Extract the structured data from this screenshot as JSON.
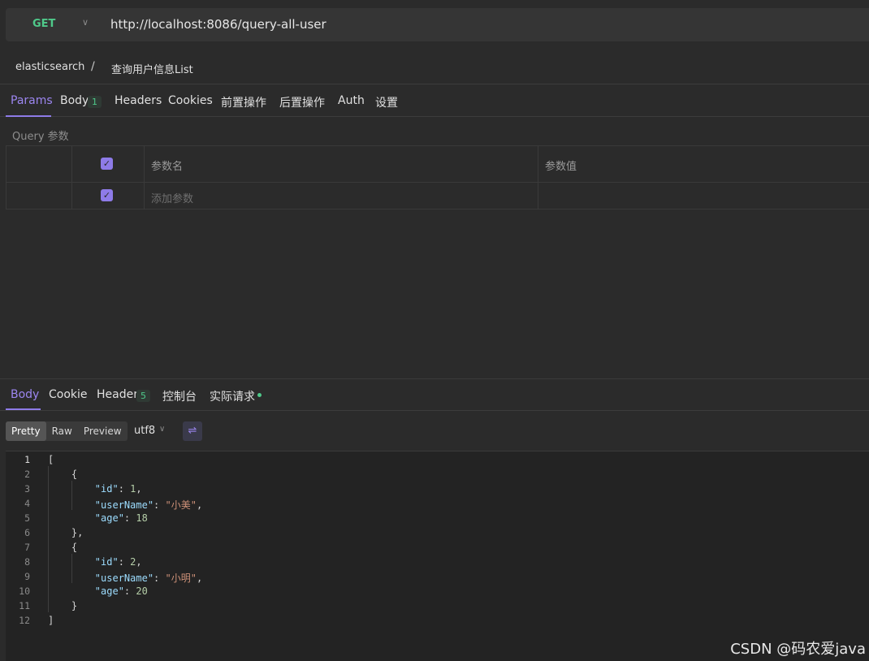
{
  "request": {
    "method": "GET",
    "url": "http://localhost:8086/query-all-user"
  },
  "breadcrumb": {
    "collection": "elasticsearch",
    "separator": "/",
    "request_name": "查询用户信息List"
  },
  "request_tabs": [
    {
      "label": "Params",
      "active": true
    },
    {
      "label": "Body",
      "badge": "1"
    },
    {
      "label": "Headers"
    },
    {
      "label": "Cookies"
    },
    {
      "label": "前置操作"
    },
    {
      "label": "后置操作"
    },
    {
      "label": "Auth"
    },
    {
      "label": "设置"
    }
  ],
  "params": {
    "section_title": "Query 参数",
    "col_name": "参数名",
    "col_value": "参数值",
    "add_placeholder": "添加参数"
  },
  "response_tabs": [
    {
      "label": "Body",
      "active": true
    },
    {
      "label": "Cookie"
    },
    {
      "label": "Header",
      "badge": "5"
    },
    {
      "label": "控制台"
    },
    {
      "label": "实际请求"
    }
  ],
  "view_modes": [
    "Pretty",
    "Raw",
    "Preview"
  ],
  "encoding": "utf8",
  "code_lines": [
    {
      "n": "1"
    },
    {
      "n": "2"
    },
    {
      "n": "3"
    },
    {
      "n": "4"
    },
    {
      "n": "5"
    },
    {
      "n": "6"
    },
    {
      "n": "7"
    },
    {
      "n": "8"
    },
    {
      "n": "9"
    },
    {
      "n": "10"
    },
    {
      "n": "11"
    },
    {
      "n": "12"
    }
  ],
  "response_json": {
    "open_bracket": "[",
    "close_bracket": "]",
    "open_brace": "{",
    "close_brace_comma": "},",
    "close_brace": "}",
    "key_id": "\"id\"",
    "key_username": "\"userName\"",
    "key_age": "\"age\"",
    "user1_id": "1",
    "user1_name": "\"小美\"",
    "user1_age": "18",
    "user2_id": "2",
    "user2_name": "\"小明\"",
    "user2_age": "20"
  },
  "watermark": "CSDN @码农爱java",
  "colors": {
    "accent": "#8e7be8",
    "method_get": "#4fc98a",
    "json_key": "#9cdcfe",
    "json_number": "#b5cea8",
    "json_string": "#ce9178"
  }
}
